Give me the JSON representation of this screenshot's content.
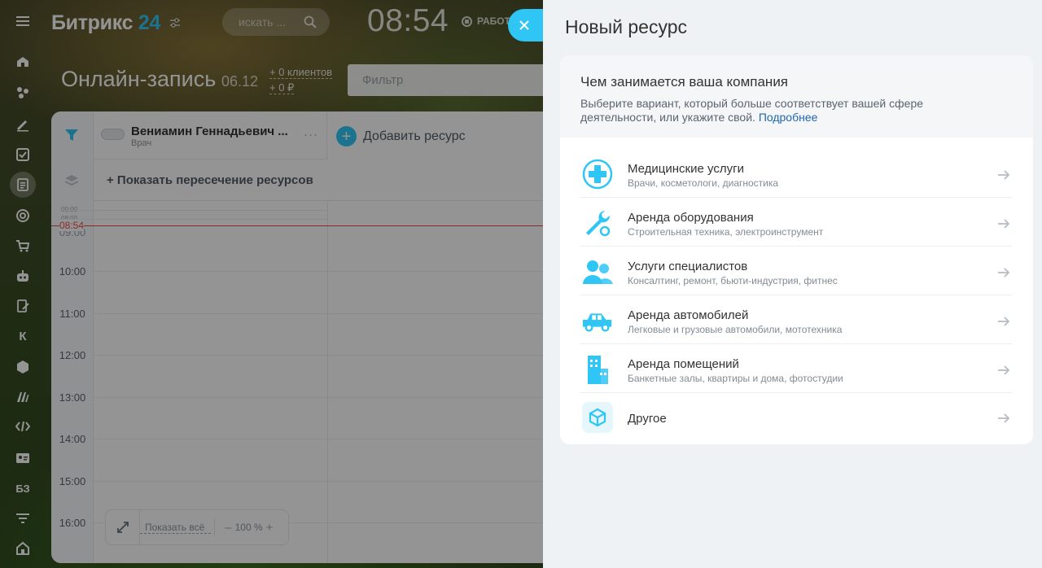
{
  "colors": {
    "accent": "#2fc6f6",
    "now_line": "#e84c4c",
    "link": "#2067b0"
  },
  "header": {
    "logo_text": "Битрикс",
    "logo_num": "24",
    "search_placeholder": "искать ...",
    "clock": "08:54",
    "work_status": "РАБОТ"
  },
  "leftnav": {
    "items": [
      {
        "icon": "menu-icon"
      },
      {
        "icon": "home-icon"
      },
      {
        "icon": "crm-icon"
      },
      {
        "icon": "sign-icon"
      },
      {
        "icon": "tasks-icon"
      },
      {
        "icon": "booking-icon",
        "active": true
      },
      {
        "icon": "target-icon"
      },
      {
        "icon": "cart-icon"
      },
      {
        "icon": "robot-icon"
      },
      {
        "icon": "docs-edit-icon"
      },
      {
        "icon": "k-icon",
        "label": "К"
      },
      {
        "icon": "box-icon"
      },
      {
        "icon": "market-icon"
      },
      {
        "icon": "code-icon"
      },
      {
        "icon": "contact-card-icon"
      },
      {
        "icon": "kb-icon",
        "label": "БЗ"
      },
      {
        "icon": "filter-funnel-icon"
      },
      {
        "icon": "company-icon"
      }
    ]
  },
  "page": {
    "title": "Онлайн-запись",
    "date": "06.12",
    "clients": "+ 0 клиентов",
    "money": "+ 0 ₽",
    "filter_placeholder": "Фильтр"
  },
  "calendar": {
    "resource_name": "Вениамин Геннадьевич ...",
    "resource_role": "Врач",
    "more": "···",
    "add_resource": "Добавить ресурс",
    "intersection": "+ Показать пересечение ресурсов",
    "small_times": [
      "00:00",
      "08:00"
    ],
    "now_label": "08:54",
    "now_under": "09:00",
    "hours": [
      "10:00",
      "11:00",
      "12:00",
      "13:00",
      "14:00",
      "15:00",
      "16:00"
    ],
    "show_all": "Показать всё",
    "zoom_minus": "–",
    "zoom_value": "100 %",
    "zoom_plus": "+"
  },
  "panel": {
    "title": "Новый ресурс",
    "card_title": "Чем занимается ваша компания",
    "card_desc": "Выберите вариант, который больше соответствует вашей сфере деятельности, или укажите свой.",
    "card_link": "Подробнее",
    "options": [
      {
        "icon": "medical-cross-icon",
        "title": "Медицинские услуги",
        "subtitle": "Врачи, косметологи, диагностика"
      },
      {
        "icon": "wrench-icon",
        "title": "Аренда оборудования",
        "subtitle": "Строительная техника, электроинструмент"
      },
      {
        "icon": "people-icon",
        "title": "Услуги специалистов",
        "subtitle": "Консалтинг, ремонт, бьюти-индустрия, фитнес"
      },
      {
        "icon": "car-icon",
        "title": "Аренда автомобилей",
        "subtitle": "Легковые и грузовые автомобили, мототехника"
      },
      {
        "icon": "building-icon",
        "title": "Аренда помещений",
        "subtitle": "Банкетные залы, квартиры и дома, фотостудии"
      },
      {
        "icon": "cube-icon",
        "title": "Другое",
        "subtitle": ""
      }
    ]
  }
}
